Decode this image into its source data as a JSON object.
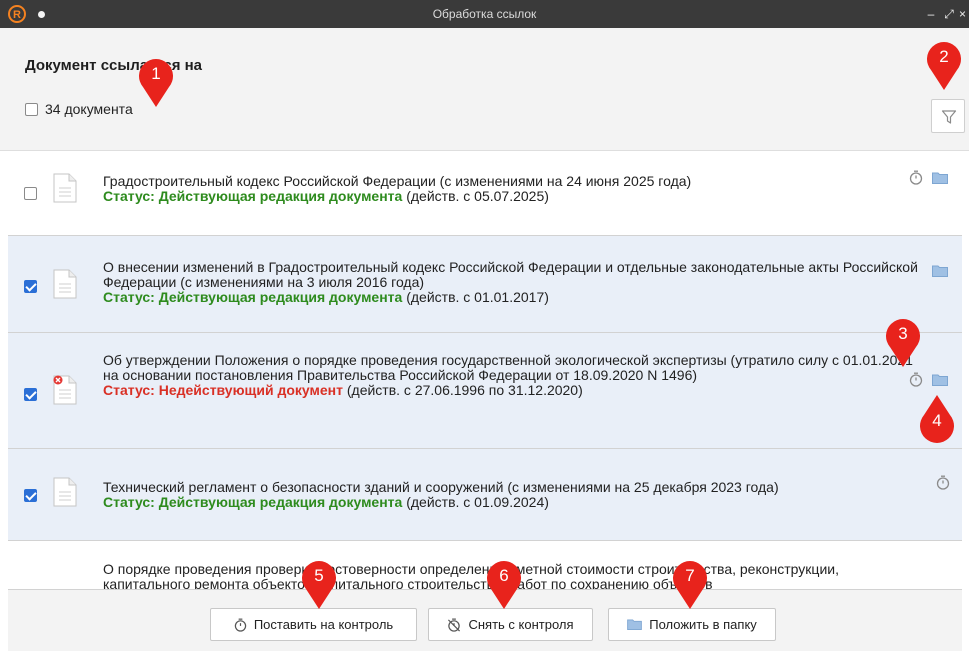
{
  "window": {
    "title": "Обработка ссылок",
    "minimize_label": "–",
    "maximize_label": "⤢",
    "close_label": "×"
  },
  "header": {
    "heading": "Документ ссылается на",
    "select_all_label": "34 документа"
  },
  "documents": [
    {
      "title": "Градостроительный кодекс Российской Федерации (с изменениями на 24 июня 2025 года)",
      "status_label": "Статус: Действующая редакция документа",
      "status_detail": " (действ. с 05.07.2025)",
      "checked": false
    },
    {
      "title": "О внесении изменений в Градостроительный кодекс Российской Федерации и отдельные законодательные акты Российской Федерации (с изменениями на 3 июля 2016 года)",
      "status_label": "Статус: Действующая редакция документа",
      "status_detail": " (действ. с 01.01.2017)",
      "checked": true
    },
    {
      "title": "Об утверждении Положения о порядке проведения государственной экологической экспертизы (утратило силу с 01.01.2021 на основании постановления Правительства Российской Федерации от 18.09.2020 N 1496)",
      "status_label": "Статус: Недействующий документ",
      "status_detail": " (действ. с 27.06.1996 по 31.12.2020)",
      "checked": true
    },
    {
      "title": "Технический регламент о безопасности зданий и сооружений (с изменениями на 25 декабря 2023 года)",
      "status_label": "Статус: Действующая редакция документа",
      "status_detail": " (действ. с 01.09.2024)",
      "checked": true
    },
    {
      "title": "О порядке проведения проверки достоверности определения сметной стоимости строительства, реконструкции, капитального ремонта объектов капитального строительства, работ по сохранению объектов",
      "checked": false
    }
  ],
  "actions": {
    "set_control": "Поставить на контроль",
    "remove_control": "Снять с контроля",
    "put_in_folder": "Положить в папку"
  },
  "callouts": [
    "1",
    "2",
    "3",
    "4",
    "5",
    "6",
    "7"
  ],
  "colors": {
    "status_active": "#2e8b1e",
    "status_inactive": "#d93025",
    "selected_row": "#e9eff8",
    "callout": "#e8231c",
    "logo": "#f58220"
  }
}
